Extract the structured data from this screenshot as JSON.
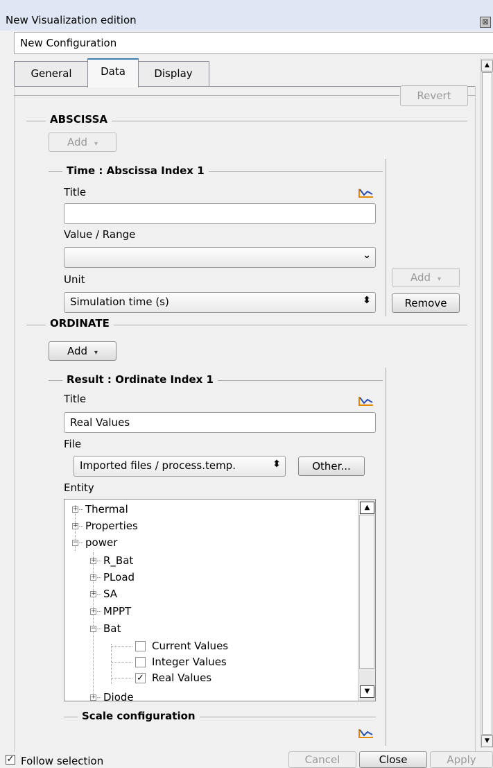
{
  "window": {
    "title": "New Visualization edition",
    "close_glyph": "⊠"
  },
  "config_name": "New Configuration",
  "tabs": [
    {
      "label": "General",
      "active": false
    },
    {
      "label": "Data",
      "active": true
    },
    {
      "label": "Display",
      "active": false
    }
  ],
  "revert_label": "Revert",
  "abscissa": {
    "heading": "ABSCISSA",
    "add_label": "Add",
    "group_title": "Time : Abscissa Index 1",
    "title_label": "Title",
    "title_value": "",
    "value_range_label": "Value / Range",
    "value_range_value": "",
    "unit_label": "Unit",
    "unit_value": "Simulation time (s)",
    "side_add_label": "Add",
    "side_remove_label": "Remove"
  },
  "ordinate": {
    "heading": "ORDINATE",
    "add_label": "Add",
    "group_title": "Result : Ordinate Index 1",
    "title_label": "Title",
    "title_value": "Real Values",
    "file_label": "File",
    "file_value": "Imported files / process.temp.",
    "other_label": "Other...",
    "entity_label": "Entity",
    "tree": [
      {
        "label": "Thermal",
        "expander": "+"
      },
      {
        "label": "Properties",
        "expander": "+"
      },
      {
        "label": "power",
        "expander": "−"
      },
      {
        "label": "R_Bat",
        "expander": "+"
      },
      {
        "label": "PLoad",
        "expander": "+"
      },
      {
        "label": "SA",
        "expander": "+"
      },
      {
        "label": "MPPT",
        "expander": "+"
      },
      {
        "label": "Bat",
        "expander": "−"
      },
      {
        "label": "Current Values",
        "checked": false
      },
      {
        "label": "Integer Values",
        "checked": false
      },
      {
        "label": "Real Values",
        "checked": true
      },
      {
        "label": "Diode",
        "expander": "+"
      }
    ],
    "scale_heading": "Scale configuration"
  },
  "footer": {
    "follow_label": "Follow selection",
    "follow_checked": true,
    "cancel_label": "Cancel",
    "close_label": "Close",
    "apply_label": "Apply"
  },
  "icons": {
    "plot": "plot-curve-icon",
    "scroll_up": "▲",
    "scroll_down": "▼",
    "dropdown": "▾",
    "combo": "⌄",
    "spin": "⬍",
    "check": "✓"
  },
  "colors": {
    "active_tab_accent": "#3c7fb1",
    "plot_icon_orange": "#e08a00",
    "plot_icon_blue": "#2a4fb0"
  }
}
